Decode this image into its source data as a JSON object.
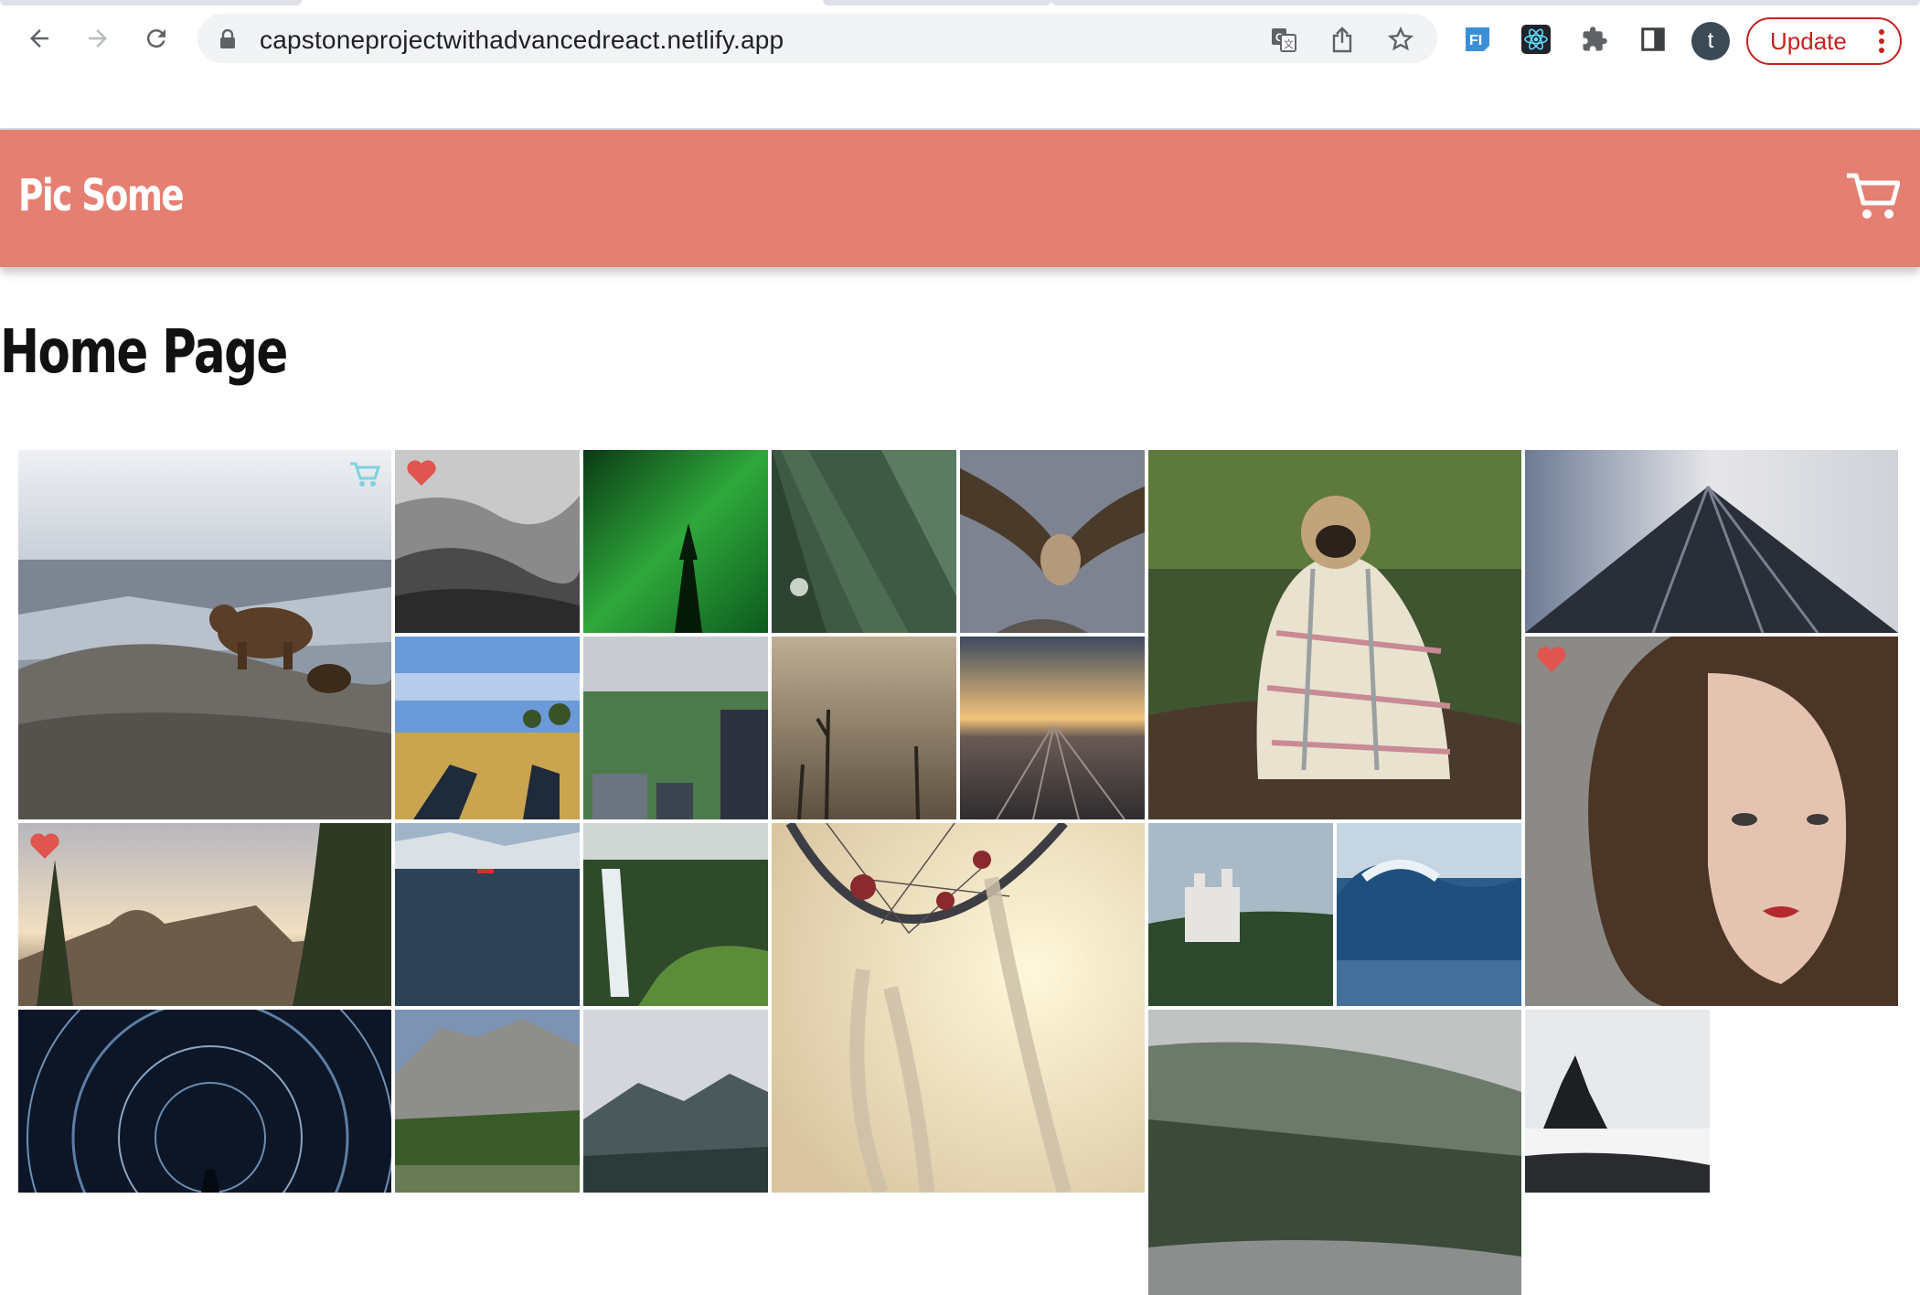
{
  "browser": {
    "url": "capstoneprojectwithadvancedreact.netlify.app",
    "profile_initial": "t",
    "update_label": "Update",
    "extension_labels": [
      "FI"
    ],
    "icons": [
      "back-arrow-icon",
      "forward-arrow-icon",
      "reload-icon",
      "lock-icon",
      "translate-icon",
      "share-icon",
      "star-icon",
      "extension-fi-icon",
      "react-devtools-icon",
      "puzzle-icon",
      "side-panel-icon",
      "more-vert-icon"
    ]
  },
  "app": {
    "title": "Pic Some",
    "page_heading": "Home Page",
    "colors": {
      "header": "#e57f72",
      "heart": "#e0554f",
      "cart_hover": "#7fd2e0"
    }
  },
  "photos": [
    {
      "subject": "bear with cub on rocks",
      "favorite": false,
      "in_cart_hover": true
    },
    {
      "subject": "misty black and white forest",
      "favorite": true
    },
    {
      "subject": "northern lights"
    },
    {
      "subject": "dense pine forest"
    },
    {
      "subject": "vulture in flight"
    },
    {
      "subject": "pug wrapped in blanket"
    },
    {
      "subject": "skyscraper looking up"
    },
    {
      "subject": "feet in wheat field"
    },
    {
      "subject": "city and park aerial"
    },
    {
      "subject": "dead trees in fog"
    },
    {
      "subject": "railway yard at sunset"
    },
    {
      "subject": "woman portrait",
      "favorite": true
    },
    {
      "subject": "half dome sunset",
      "favorite": true
    },
    {
      "subject": "lake with red boat"
    },
    {
      "subject": "waterfall in green valley"
    },
    {
      "subject": "dreamcatcher"
    },
    {
      "subject": "castle on hill"
    },
    {
      "subject": "ocean wave"
    },
    {
      "subject": "star trails"
    },
    {
      "subject": "yosemite valley"
    },
    {
      "subject": "misty mountain"
    },
    {
      "subject": "misty forest river"
    },
    {
      "subject": "sea stack beach"
    }
  ]
}
